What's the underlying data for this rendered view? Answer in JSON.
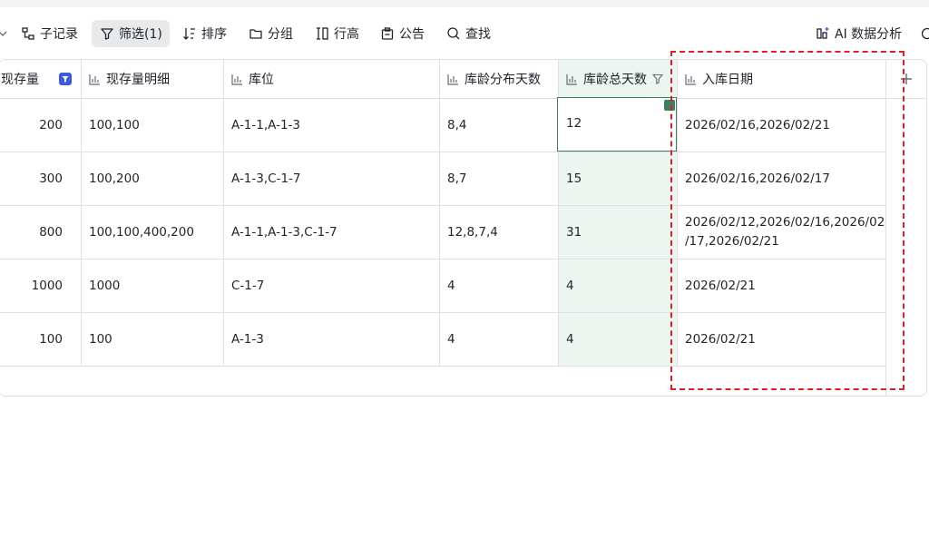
{
  "toolbar": {
    "items": [
      {
        "label": "子记录"
      },
      {
        "label": "筛选(1)"
      },
      {
        "label": "排序"
      },
      {
        "label": "分组"
      },
      {
        "label": "行高"
      },
      {
        "label": "公告"
      },
      {
        "label": "查找"
      }
    ],
    "ai_label": "AI 数据分析"
  },
  "columns": [
    {
      "title": "现存量"
    },
    {
      "title": "现存量明细"
    },
    {
      "title": "库位"
    },
    {
      "title": "库龄分布天数"
    },
    {
      "title": "库龄总天数"
    },
    {
      "title": "入库日期"
    }
  ],
  "rows": [
    {
      "qty": "200",
      "detail": "100,100",
      "loc": "A-1-1,A-1-3",
      "dist": "8,4",
      "total": "12",
      "date": "2026/02/16,2026/02/21"
    },
    {
      "qty": "300",
      "detail": "100,200",
      "loc": "A-1-3,C-1-7",
      "dist": "8,7",
      "total": "15",
      "date": "2026/02/16,2026/02/17"
    },
    {
      "qty": "800",
      "detail": "100,100,400,200",
      "loc": "A-1-1,A-1-3,C-1-7",
      "dist": "12,8,7,4",
      "total": "31",
      "date": "2026/02/12,2026/02/16,2026/02/17,2026/02/21",
      "date_line1": "2026/02/12,2026/02/16,2026/02",
      "date_line2": "/17,2026/02/21"
    },
    {
      "qty": "1000",
      "detail": "1000",
      "loc": "C-1-7",
      "dist": "4",
      "total": "4",
      "date": "2026/02/21"
    },
    {
      "qty": "100",
      "detail": "100",
      "loc": "A-1-3",
      "dist": "4",
      "total": "4",
      "date": "2026/02/21"
    }
  ],
  "colors": {
    "accent": "#3d7e5d",
    "highlight": "#ecf5ef",
    "filter_badge": "#3b5bdb",
    "annotation": "#e02020"
  }
}
